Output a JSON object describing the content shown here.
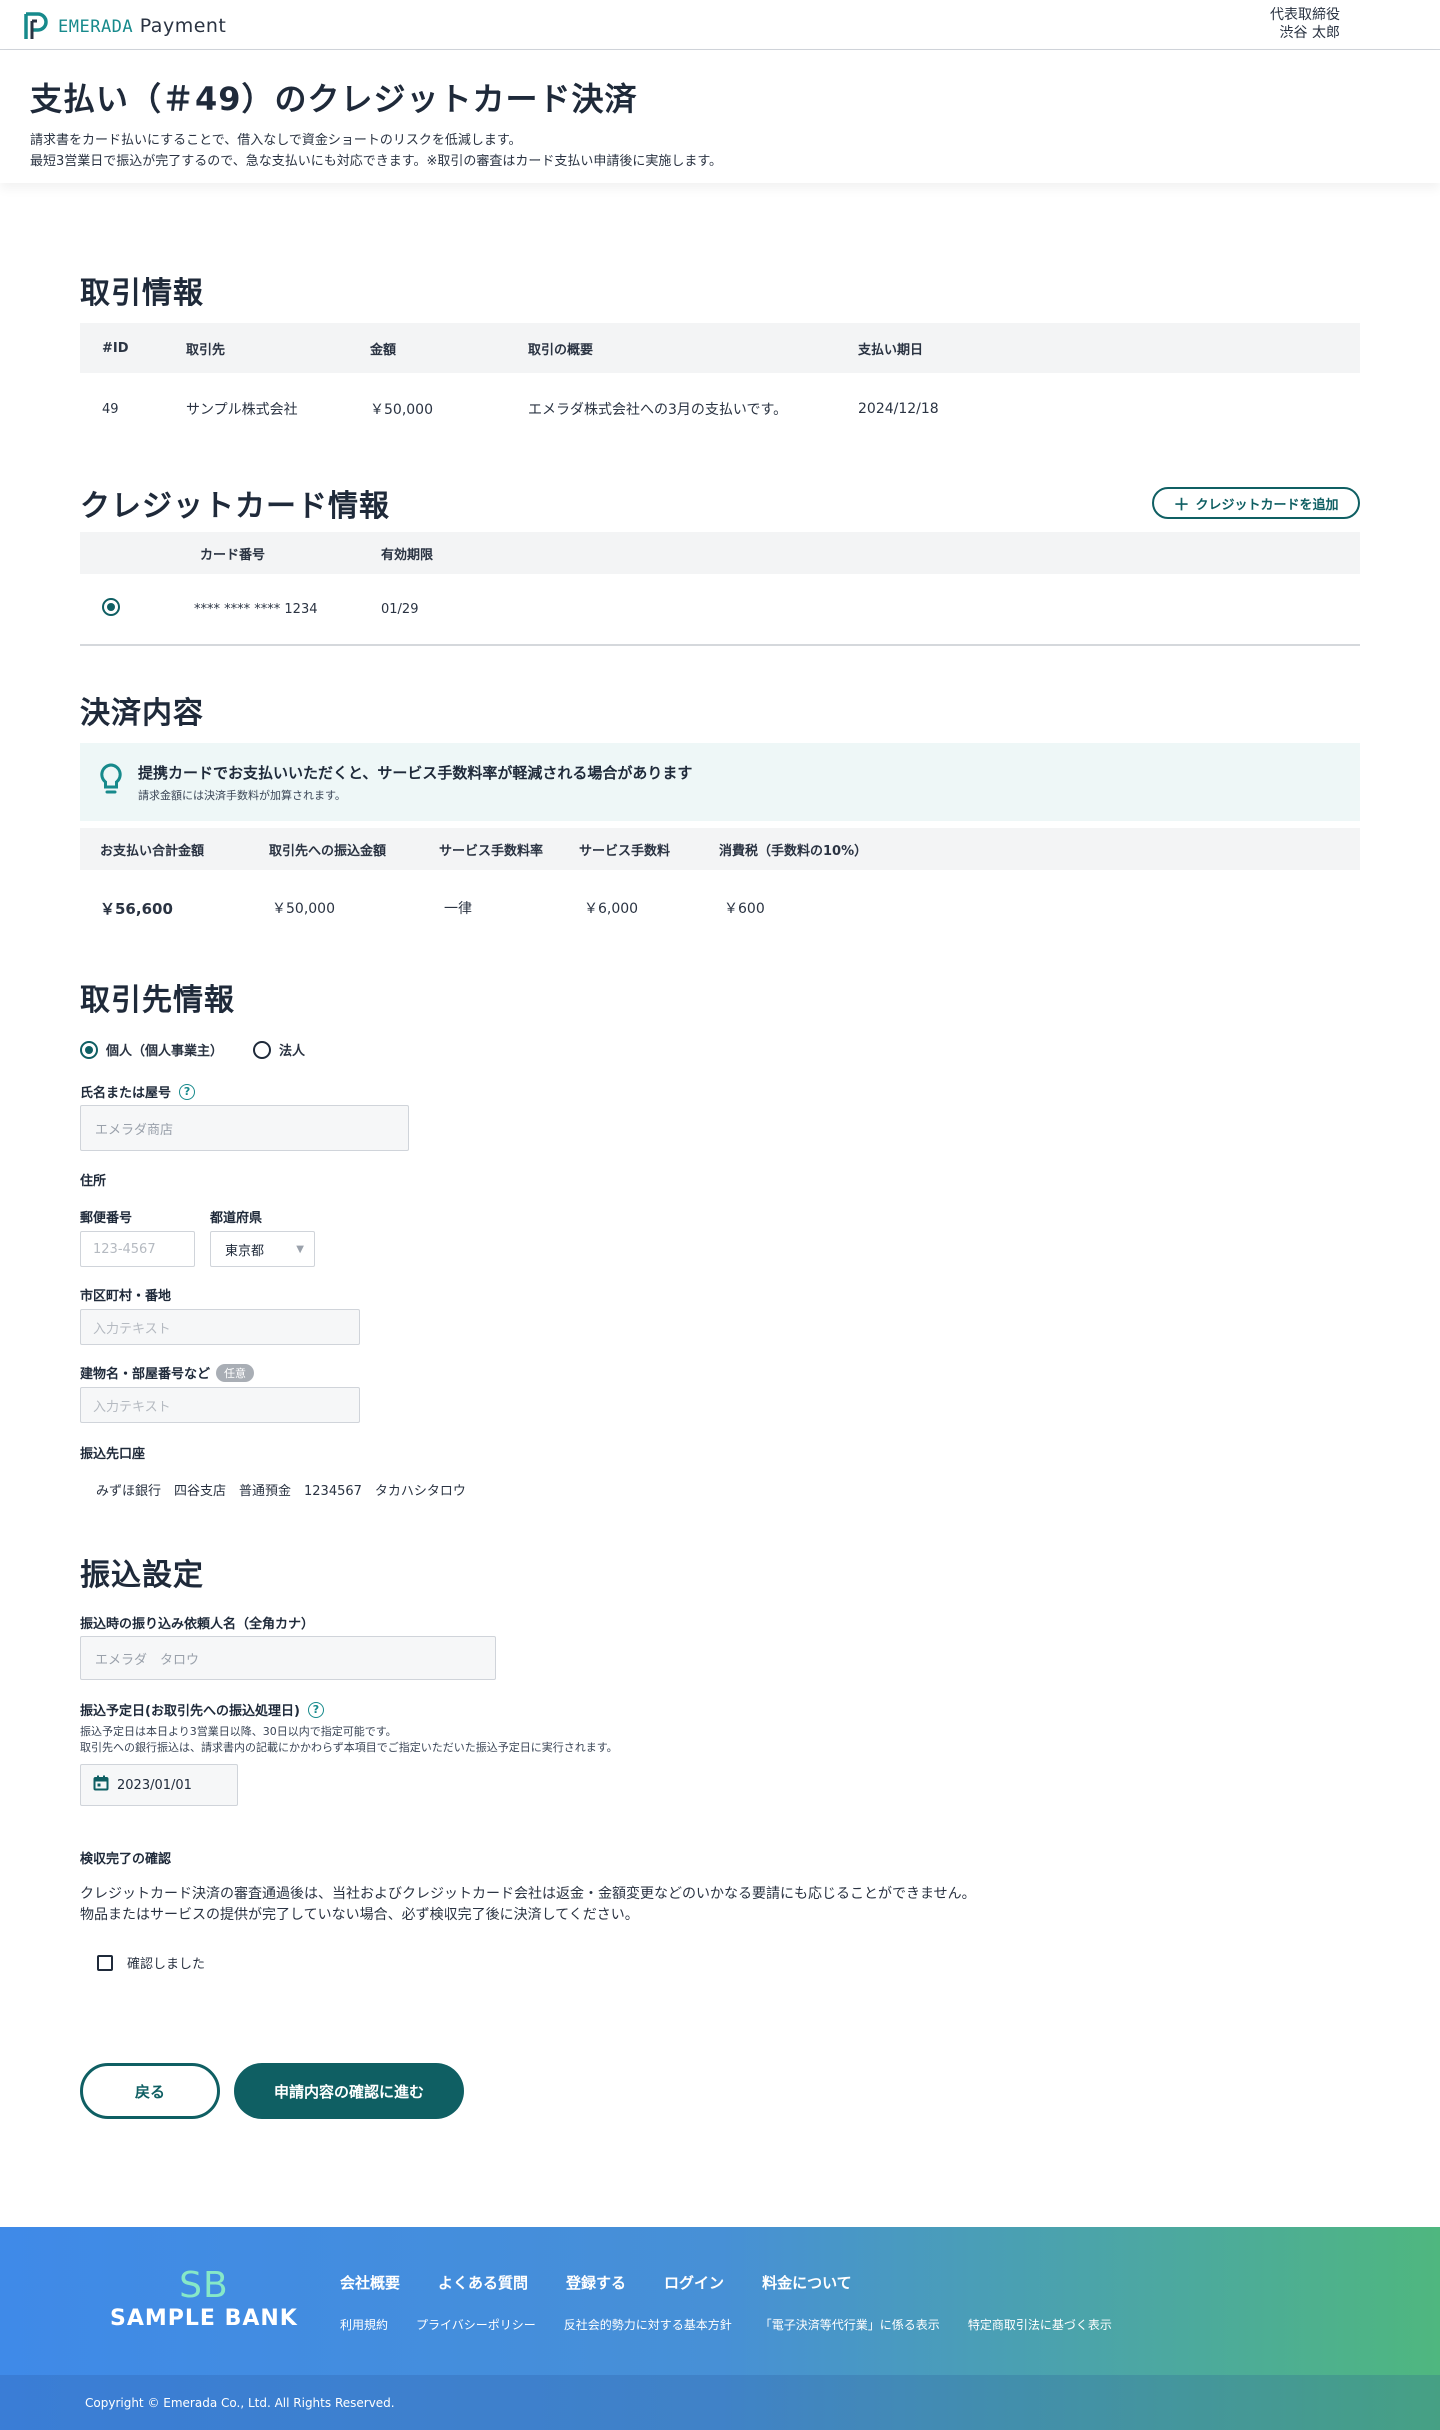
{
  "header": {
    "brand": "EMERADA",
    "product": "Payment",
    "user_role": "代表取締役",
    "user_name": "渋谷 太郎"
  },
  "hero": {
    "title": "支払い（＃49）のクレジットカード決済",
    "desc_line1": "請求書をカード払いにすることで、借入なしで資金ショートのリスクを低減します。",
    "desc_line2": "最短3営業日で振込が完了するので、急な支払いにも対応できます。※取引の審査はカード支払い申請後に実施します。"
  },
  "transaction": {
    "title": "取引情報",
    "headers": [
      "#ID",
      "取引先",
      "金額",
      "取引の概要",
      "支払い期日"
    ],
    "row": [
      "49",
      "サンプル株式会社",
      "￥50,000",
      "エメラダ株式会社への3月の支払いです。",
      "2024/12/18"
    ]
  },
  "card": {
    "title": "クレジットカード情報",
    "add_label": "クレジットカードを追加",
    "headers": [
      "カード番号",
      "有効期限"
    ],
    "row": [
      "**** **** **** 1234",
      "01/29"
    ]
  },
  "settlement": {
    "title": "決済内容",
    "notice_title": "提携カードでお支払いいただくと、サービス手数料率が軽減される場合があります",
    "notice_sub": "請求金額には決済手数料が加算されます。",
    "headers": [
      "お支払い合計金額",
      "取引先への振込金額",
      "サービス手数料率",
      "サービス手数料",
      "消費税（手数料の10%）"
    ],
    "row": [
      "￥56,600",
      "￥50,000",
      "一律",
      "￥6,000",
      "￥600"
    ]
  },
  "partner": {
    "title": "取引先情報",
    "type_individual": "個人（個人事業主）",
    "type_corporate": "法人",
    "name_label": "氏名または屋号",
    "name_placeholder": "エメラダ商店",
    "address_label": "住所",
    "zip_label": "郵便番号",
    "zip_placeholder": "123-4567",
    "pref_label": "都道府県",
    "pref_value": "東京都",
    "city_label": "市区町村・番地",
    "city_placeholder": "入力テキスト",
    "building_label": "建物名・部屋番号など",
    "optional_badge": "任意",
    "building_placeholder": "入力テキスト",
    "account_label": "振込先口座",
    "account_value": "みずほ銀行　四谷支店　普通預金　1234567　タカハシタロウ"
  },
  "transfer": {
    "title": "振込設定",
    "requester_label": "振込時の振り込み依頼人名（全角カナ）",
    "requester_placeholder": "エメラダ　タロウ",
    "date_label": "振込予定日(お取引先への振込処理日)",
    "date_note1": "振込予定日は本日より3営業日以降、30日以内で指定可能です。",
    "date_note2": "取引先への銀行振込は、請求書内の記載にかかわらず本項目でご指定いただいた振込予定日に実行されます。",
    "date_value": "2023/01/01"
  },
  "confirm": {
    "title": "検収完了の確認",
    "text1": "クレジットカード決済の審査通過後は、当社およびクレジットカード会社は返金・金額変更などのいかなる要請にも応じることができません。",
    "text2": "物品またはサービスの提供が完了していない場合、必ず検収完了後に決済してください。",
    "checkbox_label": "確認しました"
  },
  "actions": {
    "back": "戻る",
    "next": "申請内容の確認に進む"
  },
  "footer": {
    "logo_mark": "SB",
    "logo_name": "SAMPLE BANK",
    "nav": [
      "会社概要",
      "よくある質問",
      "登録する",
      "ログイン",
      "料金について"
    ],
    "links": [
      "利用規約",
      "プライバシーポリシー",
      "反社会的勢力に対する基本方針",
      "「電子決済等代行業」に係る表示",
      "特定商取引法に基づく表示"
    ],
    "copyright": "Copyright © Emerada Co., Ltd. All Rights Reserved."
  },
  "colors": {
    "accent": "#0f5f63",
    "brand": "#178a8c",
    "text": "#1f2a3a"
  }
}
